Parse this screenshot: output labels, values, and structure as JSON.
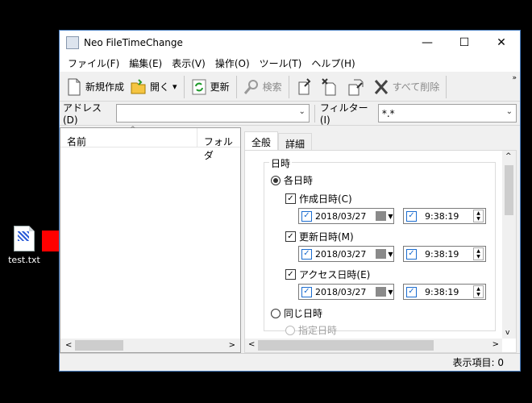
{
  "desktop": {
    "file_label": "test.txt"
  },
  "window": {
    "title": "Neo FileTimeChange",
    "minimize": "—",
    "maximize": "☐",
    "close": "✕"
  },
  "menu": [
    "ファイル(F)",
    "編集(E)",
    "表示(V)",
    "操作(O)",
    "ツール(T)",
    "ヘルプ(H)"
  ],
  "toolbar": {
    "new": "新規作成",
    "open": "開く",
    "open_arrow": "▾",
    "refresh": "更新",
    "search": "検索",
    "delete_all": "すべて削除",
    "overflow": "»"
  },
  "address": {
    "label": "アドレス(D)",
    "value": ""
  },
  "filter": {
    "label": "フィルター(I)",
    "value": "*.*"
  },
  "list": {
    "col_name": "名前",
    "col_folder": "フォルダ",
    "scroll_left": "<",
    "scroll_right": ">"
  },
  "tabs": [
    "全般",
    "詳細"
  ],
  "general": {
    "group": "日時",
    "each": "各日時",
    "created": "作成日時(C)",
    "modified": "更新日時(M)",
    "accessed": "アクセス日時(E)",
    "date": "2018/03/27",
    "time": "9:38:19",
    "same": "同じ日時",
    "same_sub": "指定日時"
  },
  "scroll": {
    "up": "^",
    "down": "v",
    "left": "<",
    "right": ">"
  },
  "status": {
    "text": "表示項目: 0"
  },
  "colors": {
    "accent": "#1c6dd0",
    "arrow": "#ff0000",
    "window_border": "#4a7fc1"
  }
}
